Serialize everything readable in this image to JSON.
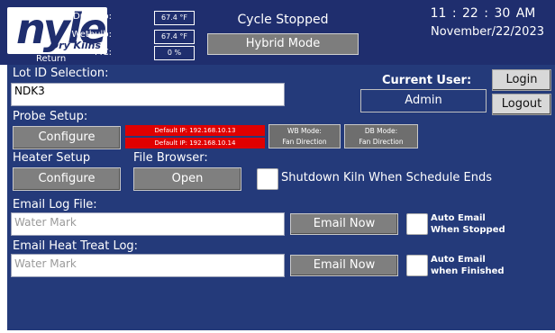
{
  "logo": {
    "main": "nyle",
    "sub": "Dry Kilns"
  },
  "return_label": "Return",
  "sensors": {
    "drybulb_label": "Drybulb:",
    "drybulb_value": "67.4 °F",
    "wetbulb_label": "Wetbulb:",
    "wetbulb_value": "67.4 °F",
    "mc_label": "MC:",
    "mc_value": "0 %"
  },
  "status": {
    "cycle": "Cycle Stopped",
    "mode": "Hybrid Mode"
  },
  "clock": {
    "time": "11 : 22 : 30  AM",
    "date": "November/22/2023"
  },
  "lot": {
    "label": "Lot ID Selection:",
    "value": "NDK3"
  },
  "user": {
    "label": "Current User:",
    "value": "Admin",
    "login": "Login",
    "logout": "Logout"
  },
  "probe": {
    "label": "Probe Setup:",
    "configure": "Configure",
    "ip1": "Default   IP: 192.168.10.13",
    "ip2": "Default   IP: 192.168.10.14",
    "wb_mode_label": "WB Mode:",
    "wb_mode_value": "Fan Direction",
    "db_mode_label": "DB Mode:",
    "db_mode_value": "Fan Direction"
  },
  "heater": {
    "label": "Heater Setup",
    "configure": "Configure"
  },
  "file_browser": {
    "label": "File Browser:",
    "open": "Open"
  },
  "shutdown": {
    "label": "Shutdown Kiln When Schedule Ends",
    "checked": false
  },
  "email_log": {
    "label": "Email Log File:",
    "placeholder": "Water Mark",
    "button": "Email Now",
    "auto_line1": "Auto Email",
    "auto_line2": "When Stopped"
  },
  "email_heat": {
    "label": "Email Heat Treat Log:",
    "placeholder": "Water Mark",
    "button": "Email Now",
    "auto_line1": "Auto Email",
    "auto_line2": "when Finished"
  },
  "colors": {
    "background": "#243a7a",
    "header": "#1f2e6e",
    "ip_bar": "#e00000",
    "button": "#7f7f7f"
  }
}
